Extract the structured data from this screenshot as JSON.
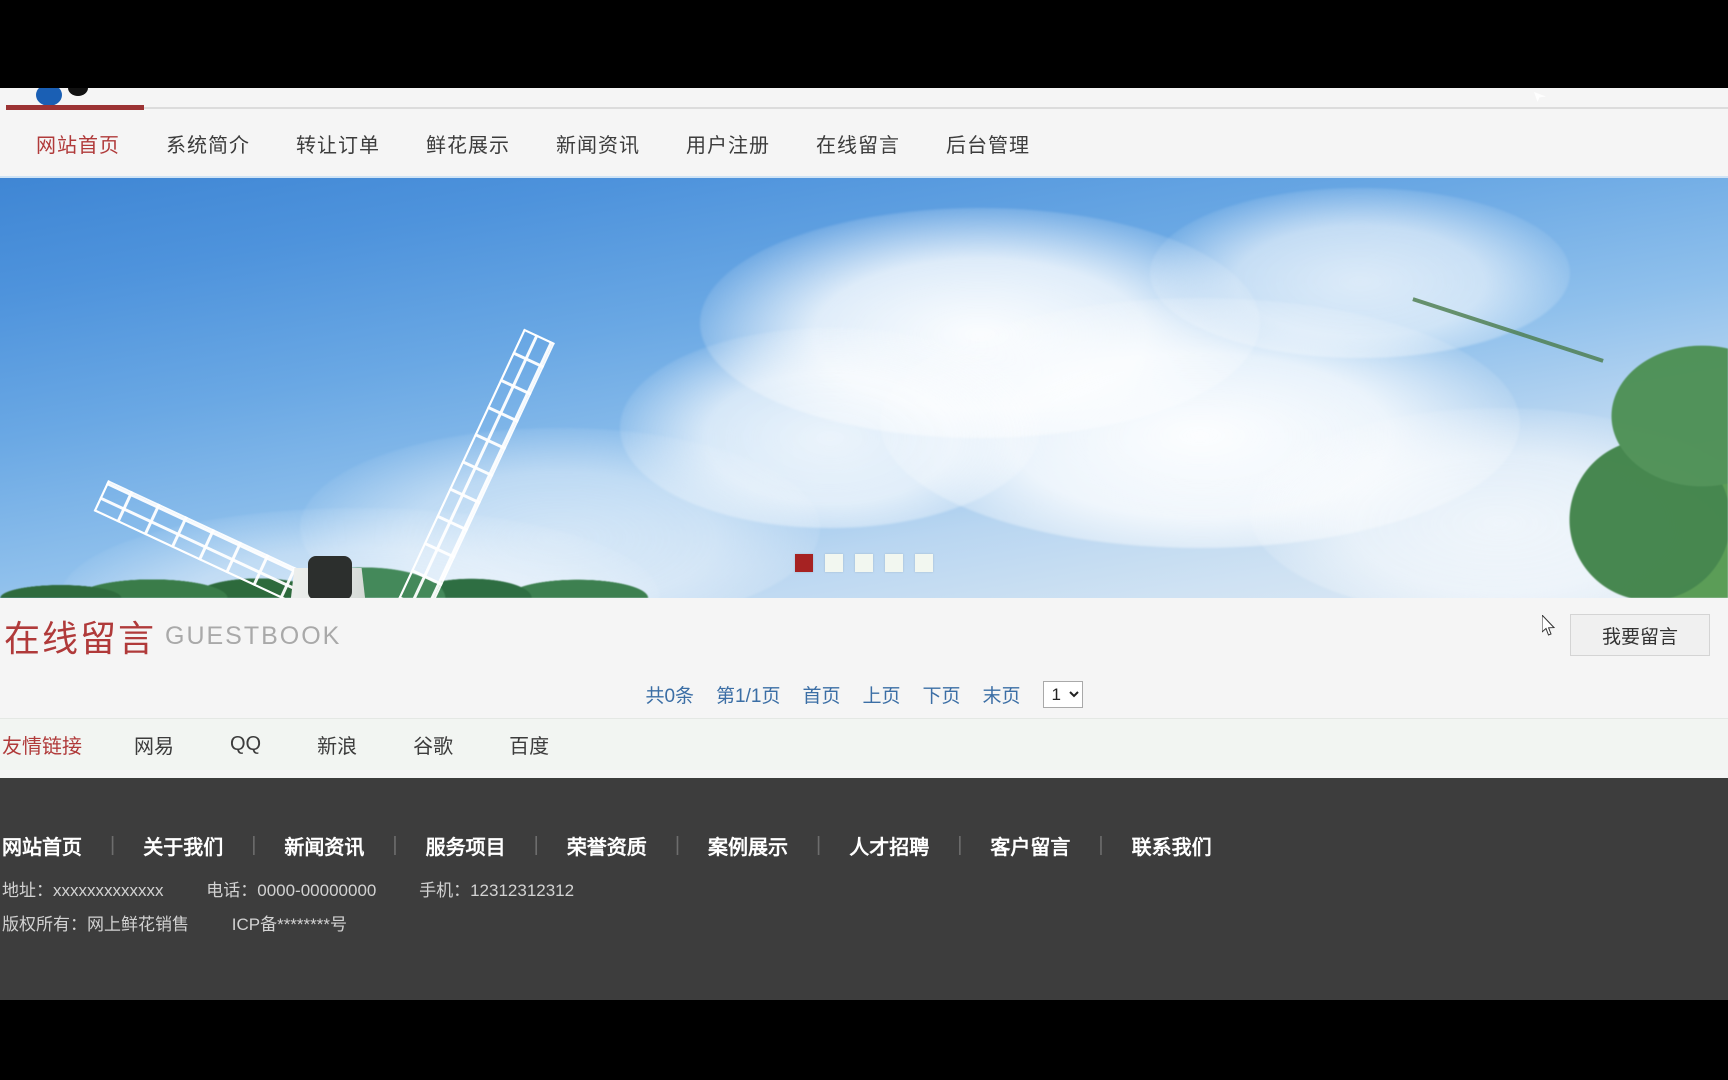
{
  "nav": {
    "items": [
      {
        "label": "网站首页",
        "active": true
      },
      {
        "label": "系统简介",
        "active": false
      },
      {
        "label": "转让订单",
        "active": false
      },
      {
        "label": "鲜花展示",
        "active": false
      },
      {
        "label": "新闻资讯",
        "active": false
      },
      {
        "label": "用户注册",
        "active": false
      },
      {
        "label": "在线留言",
        "active": false
      },
      {
        "label": "后台管理",
        "active": false
      }
    ]
  },
  "carousel": {
    "slide_count": 5,
    "active_index": 0,
    "active_color": "#a62222",
    "inactive_color": "#f2f7f0",
    "image_description": "蓝天白云 风车 风景"
  },
  "section": {
    "title_cn": "在线留言",
    "title_en": "GUESTBOOK",
    "title_color": "#b03a3a",
    "post_button": "我要留言"
  },
  "pagination": {
    "total": "共0条",
    "page_of": "第1/1页",
    "first": "首页",
    "prev": "上页",
    "next": "下页",
    "last": "末页",
    "selected_page": "1",
    "options": [
      "1"
    ],
    "link_color": "#3b6ea5"
  },
  "friend_links": {
    "title": "友情链接",
    "title_color": "#b03a3a",
    "items": [
      "网易",
      "QQ",
      "新浪",
      "谷歌",
      "百度"
    ]
  },
  "footer": {
    "nav": [
      "网站首页",
      "关于我们",
      "新闻资讯",
      "服务项目",
      "荣誉资质",
      "案例展示",
      "人才招聘",
      "客户留言",
      "联系我们"
    ],
    "separator": "|",
    "address": "地址：xxxxxxxxxxxxx",
    "phone": "电话：0000-00000000",
    "mobile": "手机：12312312312",
    "copyright": "版权所有：网上鲜花销售",
    "icp": "ICP备********号",
    "background": "#3d3d3d"
  }
}
